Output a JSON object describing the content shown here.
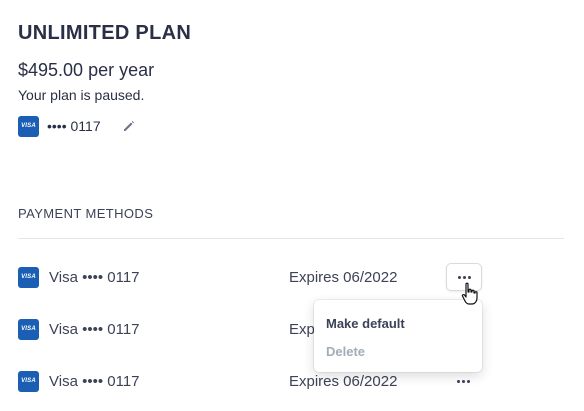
{
  "plan": {
    "title": "UNLIMITED PLAN",
    "price": "$495.00 per year",
    "status": "Your plan is paused.",
    "card": {
      "brand": "VISA",
      "number": "•••• 0117"
    }
  },
  "payment_methods": {
    "heading": "PAYMENT METHODS",
    "items": [
      {
        "brand": "VISA",
        "label": "Visa •••• 0117",
        "expires": "Expires 06/2022"
      },
      {
        "brand": "VISA",
        "label": "Visa •••• 0117",
        "expires": "Expires 06/2022"
      },
      {
        "brand": "VISA",
        "label": "Visa •••• 0117",
        "expires": "Expires 06/2022"
      }
    ]
  },
  "menu": {
    "make_default": "Make default",
    "delete": "Delete"
  },
  "colors": {
    "visa_blue": "#1a5fb4",
    "text": "#3c4257",
    "disabled": "#a3acb9"
  },
  "icons": [
    "visa-icon",
    "pencil-icon",
    "more-icon",
    "hand-cursor-icon"
  ]
}
